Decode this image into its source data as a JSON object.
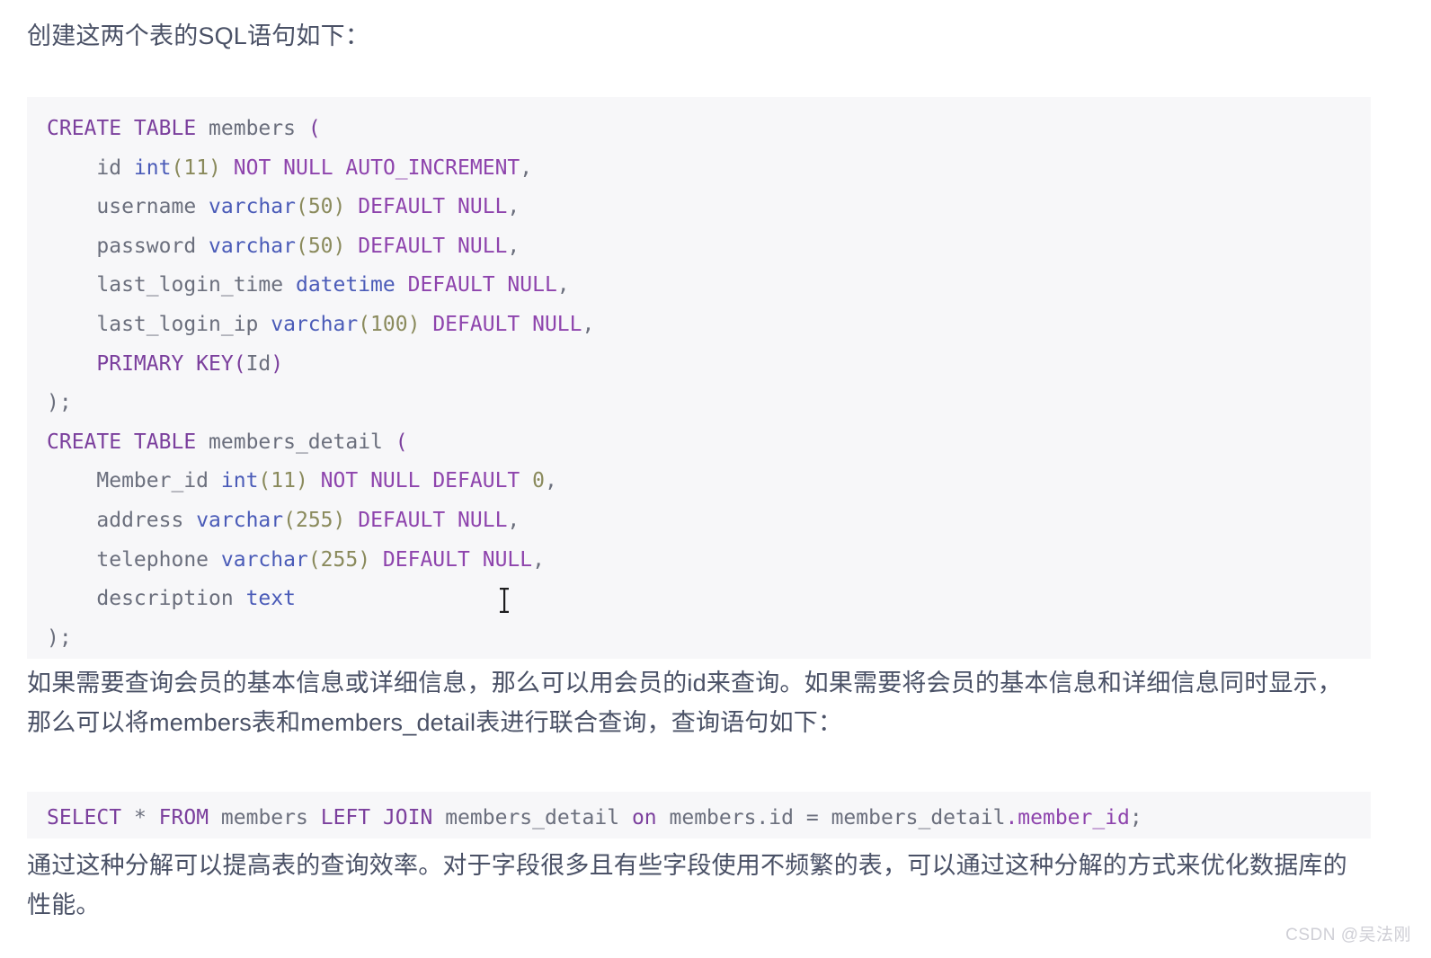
{
  "document": {
    "intro_paragraph": "创建这两个表的SQL语句如下：",
    "middle_paragraph": "如果需要查询会员的基本信息或详细信息，那么可以用会员的id来查询。如果需要将会员的基本信息和详细信息同时显示，那么可以将members表和members_detail表进行联合查询，查询语句如下：",
    "closing_paragraph": "通过这种分解可以提高表的查询效率。对于字段很多且有些字段使用不频繁的表，可以通过这种分解的方式来优化数据库的性能。",
    "watermark": "CSDN @吴法刚"
  },
  "code_blocks": [
    {
      "name": "create-table-sql",
      "language": "sql",
      "lines": [
        "CREATE TABLE members (",
        "    id int(11) NOT NULL AUTO_INCREMENT,",
        "    username varchar(50) DEFAULT NULL,",
        "    password varchar(50) DEFAULT NULL,",
        "    last_login_time datetime DEFAULT NULL,",
        "    last_login_ip varchar(100) DEFAULT NULL,",
        "    PRIMARY KEY(Id)",
        ");",
        "CREATE TABLE members_detail (",
        "    Member_id int(11) NOT NULL DEFAULT 0,",
        "    address varchar(255) DEFAULT NULL,",
        "    telephone varchar(255) DEFAULT NULL,",
        "    description text",
        ");"
      ]
    },
    {
      "name": "select-join-sql",
      "language": "sql",
      "lines": [
        "SELECT * FROM members LEFT JOIN members_detail on members.id = members_detail.member_id;"
      ]
    }
  ],
  "tokens": {
    "create_table": "CREATE TABLE",
    "members": "members",
    "members_detail": "members_detail",
    "open_paren": "(",
    "close_paren": ")",
    "semicolon": ";",
    "comma": ",",
    "id": "id",
    "int": "int",
    "paren11": "(11)",
    "not": "NOT",
    "null": "NULL",
    "auto_increment": "AUTO_INCREMENT",
    "username": "username",
    "password": "password",
    "varchar": "varchar",
    "paren50": "(50)",
    "paren100": "(100)",
    "paren255": "(255)",
    "default": "DEFAULT",
    "last_login_time": "last_login_time",
    "datetime": "datetime",
    "last_login_ip": "last_login_ip",
    "primary_key": "PRIMARY KEY",
    "id_cap": "Id",
    "member_id_cap": "Member_id",
    "zero": "0",
    "address": "address",
    "telephone": "telephone",
    "description": "description",
    "text": "text",
    "select": "SELECT",
    "star": "*",
    "from": "FROM",
    "left_join": "LEFT JOIN",
    "on": "on",
    "members_dot_id": "members.id",
    "equals": "=",
    "members_detail_base": "members_detail",
    "dot_member_id": ".member_id",
    "indent": "    "
  },
  "colors": {
    "page_background": "#ffffff",
    "code_background": "#f7f7f9",
    "prose_text": "#4a5166",
    "code_text": "#5b6272",
    "keyword_purple": "#7b3f9d",
    "keyword_magenta": "#8e44ad",
    "type_blue": "#4a5bb8",
    "number_olive": "#8a8a5c",
    "watermark": "#cfcfd6"
  }
}
